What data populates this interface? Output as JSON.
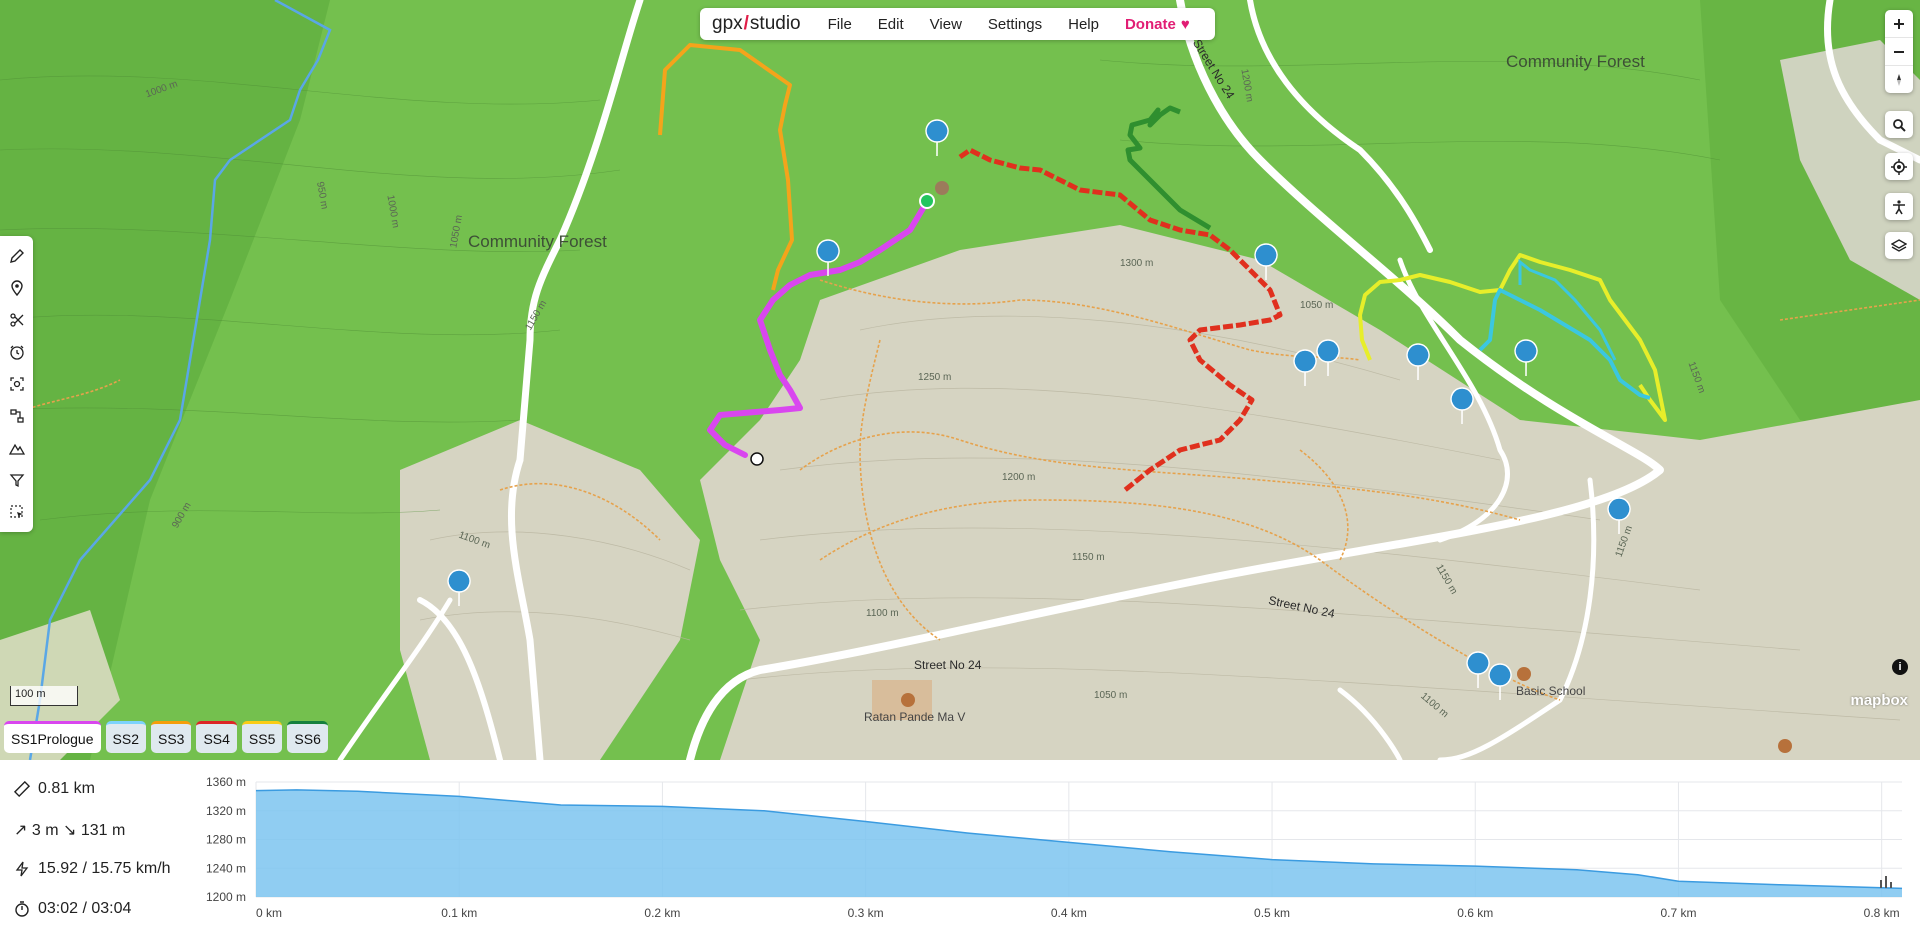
{
  "app": {
    "logo_text_left": "gpx",
    "logo_text_right": "studio",
    "menu": [
      "File",
      "Edit",
      "View",
      "Settings",
      "Help"
    ],
    "donate_label": "Donate"
  },
  "left_tools": [
    "pencil-icon",
    "pin-icon",
    "scissors-icon",
    "clock-icon",
    "scan-icon",
    "route-icon",
    "mountain-icon",
    "filter-icon",
    "select-icon"
  ],
  "right_controls": [
    "zoom-in-icon",
    "zoom-out-icon",
    "compass-icon",
    "search-icon",
    "locate-icon",
    "accessibility-icon",
    "layers-icon"
  ],
  "map": {
    "labels": {
      "community_forest_left": "Community Forest",
      "community_forest_right": "Community Forest",
      "street_top": "Street No 24",
      "street_mid": "Street No 24",
      "street_bottom": "Street No 24",
      "school": "Basic School",
      "temple": "Ratan Pande Ma V"
    },
    "contours": [
      "1300 m",
      "1250 m",
      "1200 m",
      "1150 m",
      "1100 m",
      "1150 m",
      "1100 m",
      "1050 m",
      "1000 m",
      "1150 m",
      "1050 m",
      "1100 m",
      "1150 m",
      "1150 m",
      "1200 m",
      "1000 m",
      "950 m",
      "900 m",
      "1050 m"
    ],
    "scale_label": "100 m",
    "attribution": "mapbox",
    "info_label": "i"
  },
  "tabs": [
    {
      "label": "SS1Prologue",
      "color": "#d946ef",
      "active": true
    },
    {
      "label": "SS2",
      "color": "#7dd3fc",
      "active": false
    },
    {
      "label": "SS3",
      "color": "#f59e0b",
      "active": false
    },
    {
      "label": "SS4",
      "color": "#dc2626",
      "active": false
    },
    {
      "label": "SS5",
      "color": "#facc15",
      "active": false
    },
    {
      "label": "SS6",
      "color": "#15803d",
      "active": false
    }
  ],
  "stats": {
    "distance": "0.81 km",
    "elevation": "↗ 3 m ↘ 131 m",
    "speed": "15.92 / 15.75 km/h",
    "time": "03:02 / 03:04"
  },
  "chart_data": {
    "type": "area",
    "x_unit": "km",
    "y_unit": "m",
    "xlim": [
      0,
      0.81
    ],
    "ylim": [
      1200,
      1360
    ],
    "xticks": [
      "0 km",
      "0.1 km",
      "0.2 km",
      "0.3 km",
      "0.4 km",
      "0.5 km",
      "0.6 km",
      "0.7 km",
      "0.8 km"
    ],
    "yticks": [
      "1360 m",
      "1320 m",
      "1280 m",
      "1240 m",
      "1200 m"
    ],
    "x": [
      0,
      0.02,
      0.05,
      0.1,
      0.15,
      0.2,
      0.25,
      0.3,
      0.35,
      0.4,
      0.45,
      0.5,
      0.55,
      0.6,
      0.65,
      0.68,
      0.7,
      0.75,
      0.8,
      0.81
    ],
    "y": [
      1348,
      1349,
      1347,
      1340,
      1328,
      1326,
      1320,
      1305,
      1289,
      1276,
      1263,
      1252,
      1246,
      1243,
      1238,
      1231,
      1222,
      1217,
      1213,
      1212
    ],
    "grid": true,
    "color": "#7cc4f0"
  }
}
